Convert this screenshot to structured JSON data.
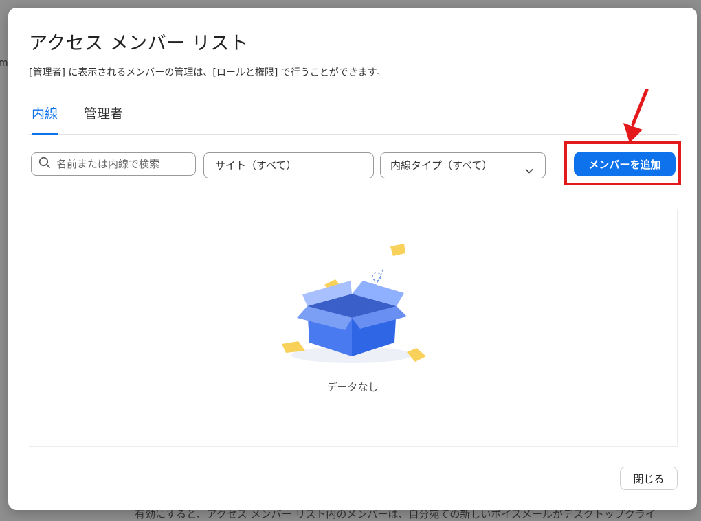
{
  "background": {
    "left_fragment": "mp",
    "bottom_text": "有効にすると、アクセス メンバー リスト内のメンバーは、自分宛ての新しいボイスメールがデスクトップクライ"
  },
  "dialog": {
    "title": "アクセス メンバー リスト",
    "subtitle": "[管理者] に表示されるメンバーの管理は、[ロールと権限] で行うことができます。",
    "tabs": [
      {
        "label": "内線",
        "active": true
      },
      {
        "label": "管理者",
        "active": false
      }
    ],
    "filters": {
      "search_placeholder": "名前または内線で検索",
      "site_value": "サイト（すべて）",
      "type_value": "内線タイプ（すべて）"
    },
    "add_button_label": "メンバーを追加",
    "empty_state_text": "データなし",
    "close_button_label": "閉じる"
  },
  "colors": {
    "accent": "#0e72ed",
    "highlight": "#e3191c"
  },
  "icons": [
    "search-icon",
    "chevron-down-icon",
    "annotation-arrow",
    "empty-box-illustration"
  ]
}
